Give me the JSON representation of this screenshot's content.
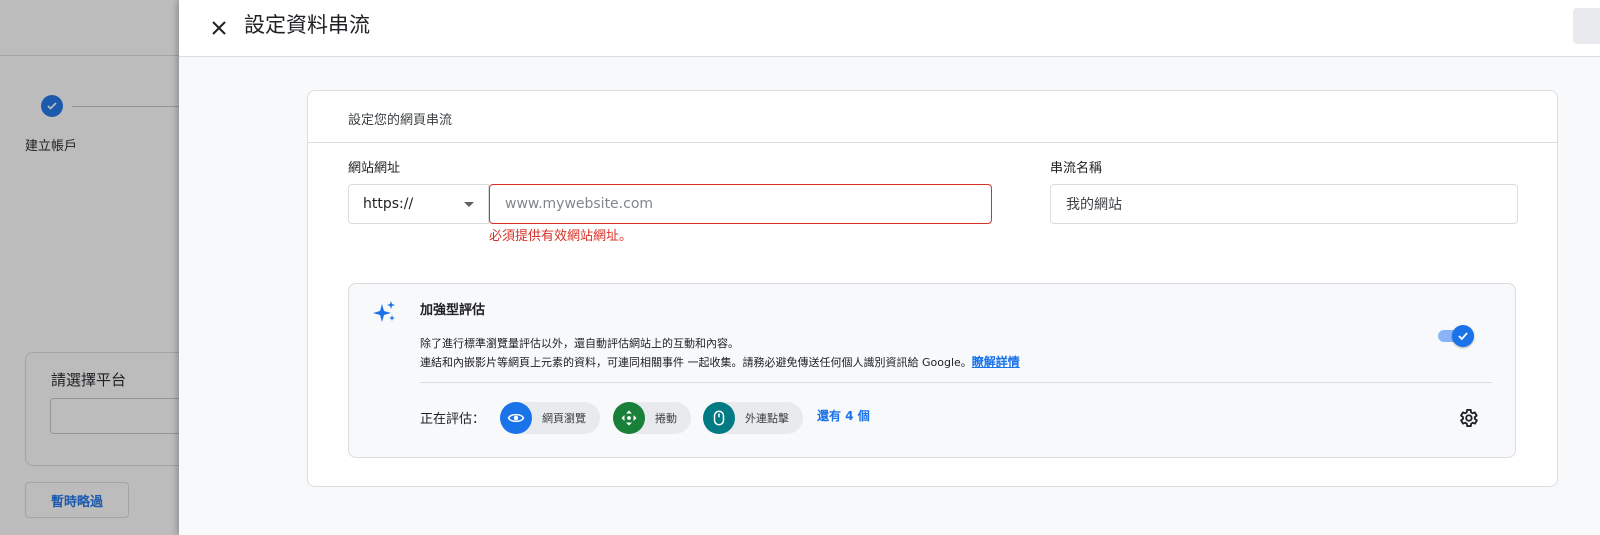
{
  "background": {
    "step_label": "建立帳戶",
    "platform_card_title": "請選擇平台",
    "skip_button": "暫時略過"
  },
  "panel": {
    "title": "設定資料串流",
    "card_header": "設定您的網頁串流",
    "website_url": {
      "label": "網站網址",
      "protocol": "https://",
      "placeholder": "www.mywebsite.com",
      "error": "必須提供有效網站網址。"
    },
    "stream_name": {
      "label": "串流名稱",
      "value": "我的網站"
    },
    "enhanced": {
      "title": "加強型評估",
      "desc_line1": "除了進行標準瀏覽量評估以外，還自動評估網站上的互動和內容。",
      "desc_line2": "連結和內嵌影片等網頁上元素的資料，可連同相關事件 一起收集。請務必避免傳送任何個人識別資訊給 Google。",
      "learn_more": "瞭解詳情",
      "toggle_on": true,
      "measuring_label": "正在評估：",
      "chips": [
        {
          "label": "網頁瀏覽",
          "icon": "eye-icon",
          "color": "#1a73e8"
        },
        {
          "label": "捲動",
          "icon": "scroll-icon",
          "color": "#188038"
        },
        {
          "label": "外連點擊",
          "icon": "mouse-icon",
          "color": "#007b83"
        }
      ],
      "more": "還有 4 個"
    }
  },
  "colors": {
    "accent": "#1a73e8",
    "error": "#d93025"
  }
}
